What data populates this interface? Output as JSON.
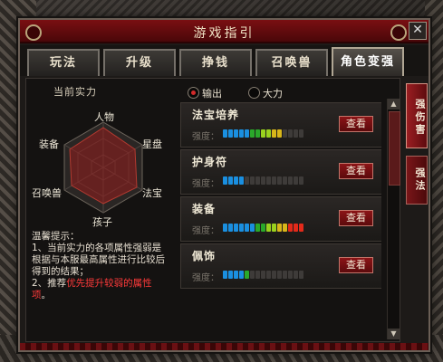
{
  "window": {
    "title": "游戏指引"
  },
  "tabs": [
    {
      "label": "玩法"
    },
    {
      "label": "升级"
    },
    {
      "label": "挣钱"
    },
    {
      "label": "召唤兽"
    },
    {
      "label": "角色变强"
    }
  ],
  "active_tab": "角色变强",
  "side_tabs": [
    {
      "label": "强伤害"
    },
    {
      "label": "强法"
    }
  ],
  "left_panel": {
    "header": "当前实力",
    "radar": [
      "人物",
      "星盘",
      "法宝",
      "孩子",
      "召唤兽",
      "装备"
    ],
    "tips": {
      "title": "温馨提示：",
      "line1": "1、当前实力的各项属性强弱是根据与本服最高属性进行比较后得到的结果；",
      "line2_prefix": "2、推荐",
      "line2_red": "优先提升较弱的属性项",
      "line2_suffix": "。"
    }
  },
  "mode": {
    "option1": "输出",
    "option2": "大力",
    "selected": "输出"
  },
  "strength_label": "强度：",
  "items": [
    {
      "name": "法宝培养",
      "button": "查看",
      "level": 0.73,
      "colors": [
        "#1a8fe0",
        "#1a8fe0",
        "#1a8fe0",
        "#1a8fe0",
        "#1a8fe0",
        "#2aa82a",
        "#2aa82a",
        "#9ad11e",
        "#9ad11e",
        "#d8b61a",
        "#d8b61a"
      ]
    },
    {
      "name": "护身符",
      "button": "查看",
      "level": 0.27,
      "colors": [
        "#1a8fe0",
        "#1a8fe0",
        "#1a8fe0",
        "#1a8fe0"
      ]
    },
    {
      "name": "装备",
      "button": "查看",
      "level": 1.0,
      "colors": [
        "#1a8fe0",
        "#1a8fe0",
        "#1a8fe0",
        "#1a8fe0",
        "#1a8fe0",
        "#1a8fe0",
        "#2aa82a",
        "#2aa82a",
        "#9ad11e",
        "#9ad11e",
        "#d8b61a",
        "#d8b61a",
        "#e32a1a",
        "#e32a1a",
        "#e32a1a"
      ]
    },
    {
      "name": "佩饰",
      "button": "查看",
      "level": 0.33,
      "colors": [
        "#1a8fe0",
        "#1a8fe0",
        "#1a8fe0",
        "#1a8fe0",
        "#2aa82a"
      ]
    }
  ],
  "colors": {
    "accent": "#7a0f12",
    "button": "#8b1417"
  }
}
